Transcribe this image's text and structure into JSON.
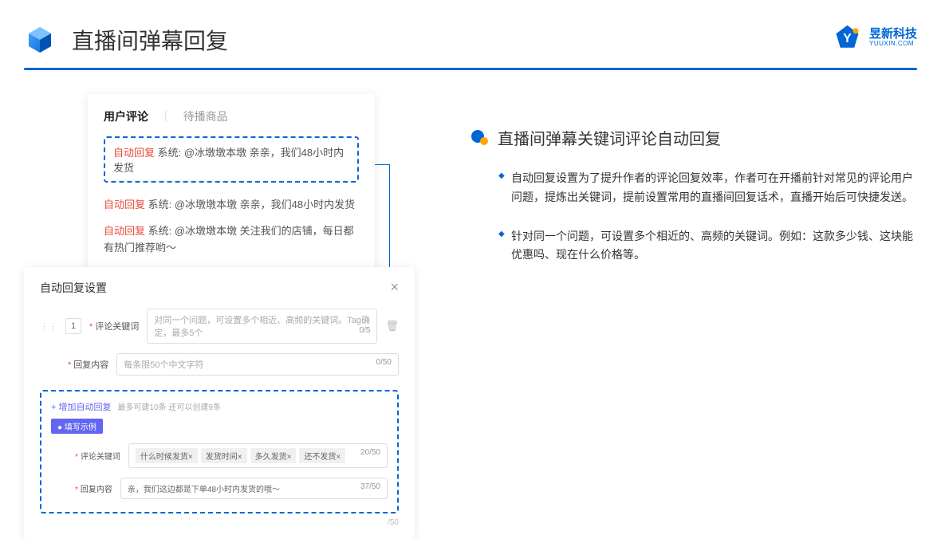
{
  "header": {
    "title": "直播间弹幕回复",
    "brand_cn": "昱新科技",
    "brand_en": "YUUXIN.COM"
  },
  "card1": {
    "tab_active": "用户评论",
    "tab_inactive": "待播商品",
    "highlight_tag": "自动回复",
    "highlight_text": " 系统: @冰墩墩本墩 亲亲，我们48小时内发货",
    "row2_tag": "自动回复",
    "row2_text": " 系统: @冰墩墩本墩 亲亲，我们48小时内发货",
    "row3_tag": "自动回复",
    "row3_text": " 系统: @冰墩墩本墩 关注我们的店铺，每日都有热门推荐哟～"
  },
  "card2": {
    "title": "自动回复设置",
    "num": "1",
    "label_keyword": "评论关键词",
    "placeholder_keyword": "对同一个问题，可设置多个相近、高频的关键词。Tag确定，最多5个",
    "count_keyword": "0/5",
    "label_content": "回复内容",
    "placeholder_content": "每条限50个中文字符",
    "count_content": "0/50",
    "add_link": "+ 增加自动回复",
    "add_hint": "最多可建10条 还可以创建9条",
    "example_badge": "● 填写示例",
    "ex_label_keyword": "评论关键词",
    "ex_tags": [
      "什么时候发货×",
      "发货时间×",
      "多久发货×",
      "还不发货×"
    ],
    "ex_count_kw": "20/50",
    "ex_label_content": "回复内容",
    "ex_content": "亲，我们这边都是下单48小时内发货的哦～",
    "ex_count_ct": "37/50",
    "trailing_count": "/50"
  },
  "right": {
    "section_title": "直播间弹幕关键词评论自动回复",
    "bullets": [
      "自动回复设置为了提升作者的评论回复效率，作者可在开播前针对常见的评论用户问题，提炼出关键词，提前设置常用的直播间回复话术，直播开始后可快捷发送。",
      "针对同一个问题，可设置多个相近的、高频的关键词。例如：这款多少钱、这块能优惠吗、现在什么价格等。"
    ]
  }
}
